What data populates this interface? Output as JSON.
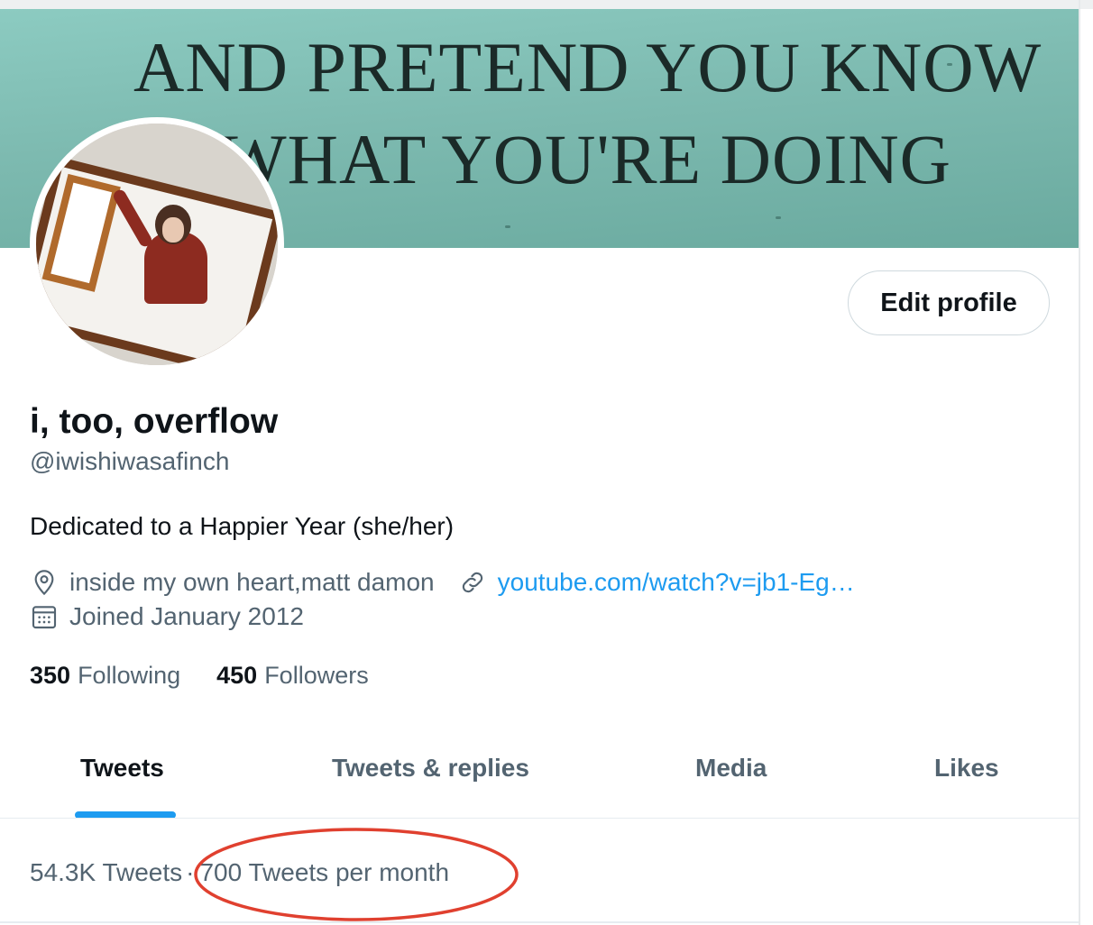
{
  "banner": {
    "line1": "AND PRETEND YOU KNOW",
    "line2": "WHAT YOU'RE DOING"
  },
  "profile": {
    "edit_label": "Edit profile",
    "display_name": "i, too, overflow",
    "handle": "@iwishiwasafinch",
    "bio": "Dedicated to a Happier Year (she/her)",
    "location": "inside my own heart,matt damon",
    "link": "youtube.com/watch?v=jb1-Eg…",
    "joined": "Joined January 2012",
    "following_count": "350",
    "following_label": "Following",
    "followers_count": "450",
    "followers_label": "Followers"
  },
  "tabs": [
    {
      "label": "Tweets",
      "active": true
    },
    {
      "label": "Tweets & replies",
      "active": false
    },
    {
      "label": "Media",
      "active": false
    },
    {
      "label": "Likes",
      "active": false
    }
  ],
  "stats": {
    "tweet_count": "54.3K Tweets",
    "separator": "·",
    "per_month": "700 Tweets per month"
  },
  "icons": {
    "location": "map-pin-icon",
    "link": "link-icon",
    "joined": "calendar-icon"
  },
  "colors": {
    "accent": "#1d9bf0",
    "annotation": "#e0402f",
    "banner": "#7dbab0"
  }
}
